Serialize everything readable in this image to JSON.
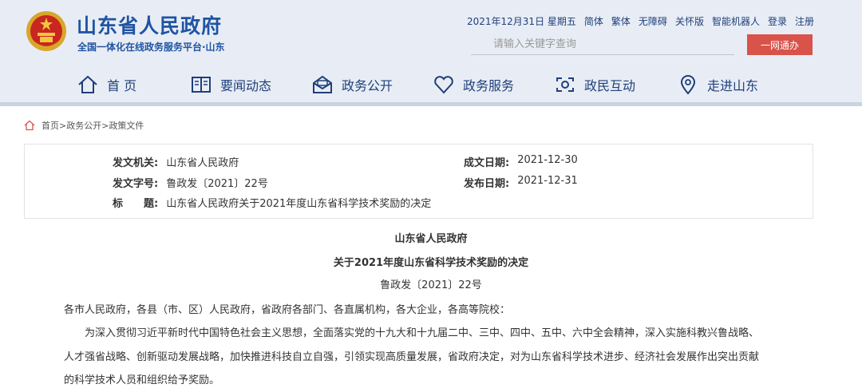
{
  "header": {
    "site_title": "山东省人民政府",
    "site_subtitle": "全国一体化在线政务服务平台·山东",
    "date": "2021年12月31日 星期五",
    "links": [
      "简体",
      "繁体",
      "无障碍",
      "关怀版",
      "智能机器人",
      "登录",
      "注册"
    ],
    "search_placeholder": "请输入关键字查询",
    "login_button": "一网通办",
    "nav": [
      {
        "label": "首 页",
        "icon": "home-icon"
      },
      {
        "label": "要闻动态",
        "icon": "news-book-icon"
      },
      {
        "label": "政务公开",
        "icon": "open-mail-icon"
      },
      {
        "label": "政务服务",
        "icon": "heart-icon"
      },
      {
        "label": "政民互动",
        "icon": "interaction-icon"
      },
      {
        "label": "走进山东",
        "icon": "location-person-icon"
      }
    ],
    "colors": {
      "brand": "#1f54a3",
      "header_bg": "#e8edf5",
      "button": "#d9534a"
    }
  },
  "breadcrumb": {
    "home": "首页",
    "sep": ">",
    "level1": "政务公开",
    "level2": "政策文件"
  },
  "meta": {
    "issuer_label": "发文机关:",
    "issuer_value": "山东省人民政府",
    "doc_no_label": "发文字号:",
    "doc_no_value": "鲁政发〔2021〕22号",
    "title_label": "标　　题:",
    "title_value": "山东省人民政府关于2021年度山东省科学技术奖励的决定",
    "created_label": "成文日期:",
    "created_value": "2021-12-30",
    "published_label": "发布日期:",
    "published_value": "2021-12-31"
  },
  "document": {
    "issuer": "山东省人民政府",
    "title": "关于2021年度山东省科学技术奖励的决定",
    "number": "鲁政发〔2021〕22号",
    "salutation": "各市人民政府，各县（市、区）人民政府，省政府各部门、各直属机构，各大企业，各高等院校：",
    "para_lines": [
      "　　为深入贯彻习近平新时代中国特色社会主义思想，全面落实党的十九大和十九届二中、三中、四中、五中、六中全会精神，深入实施科教兴鲁战略、",
      "人才强省战略、创新驱动发展战略，加快推进科技自立自强，引领实现高质量发展，省政府决定，对为山东省科学技术进步、经济社会发展作出突出贡献",
      "的科学技术人员和组织给予奖励。"
    ]
  }
}
